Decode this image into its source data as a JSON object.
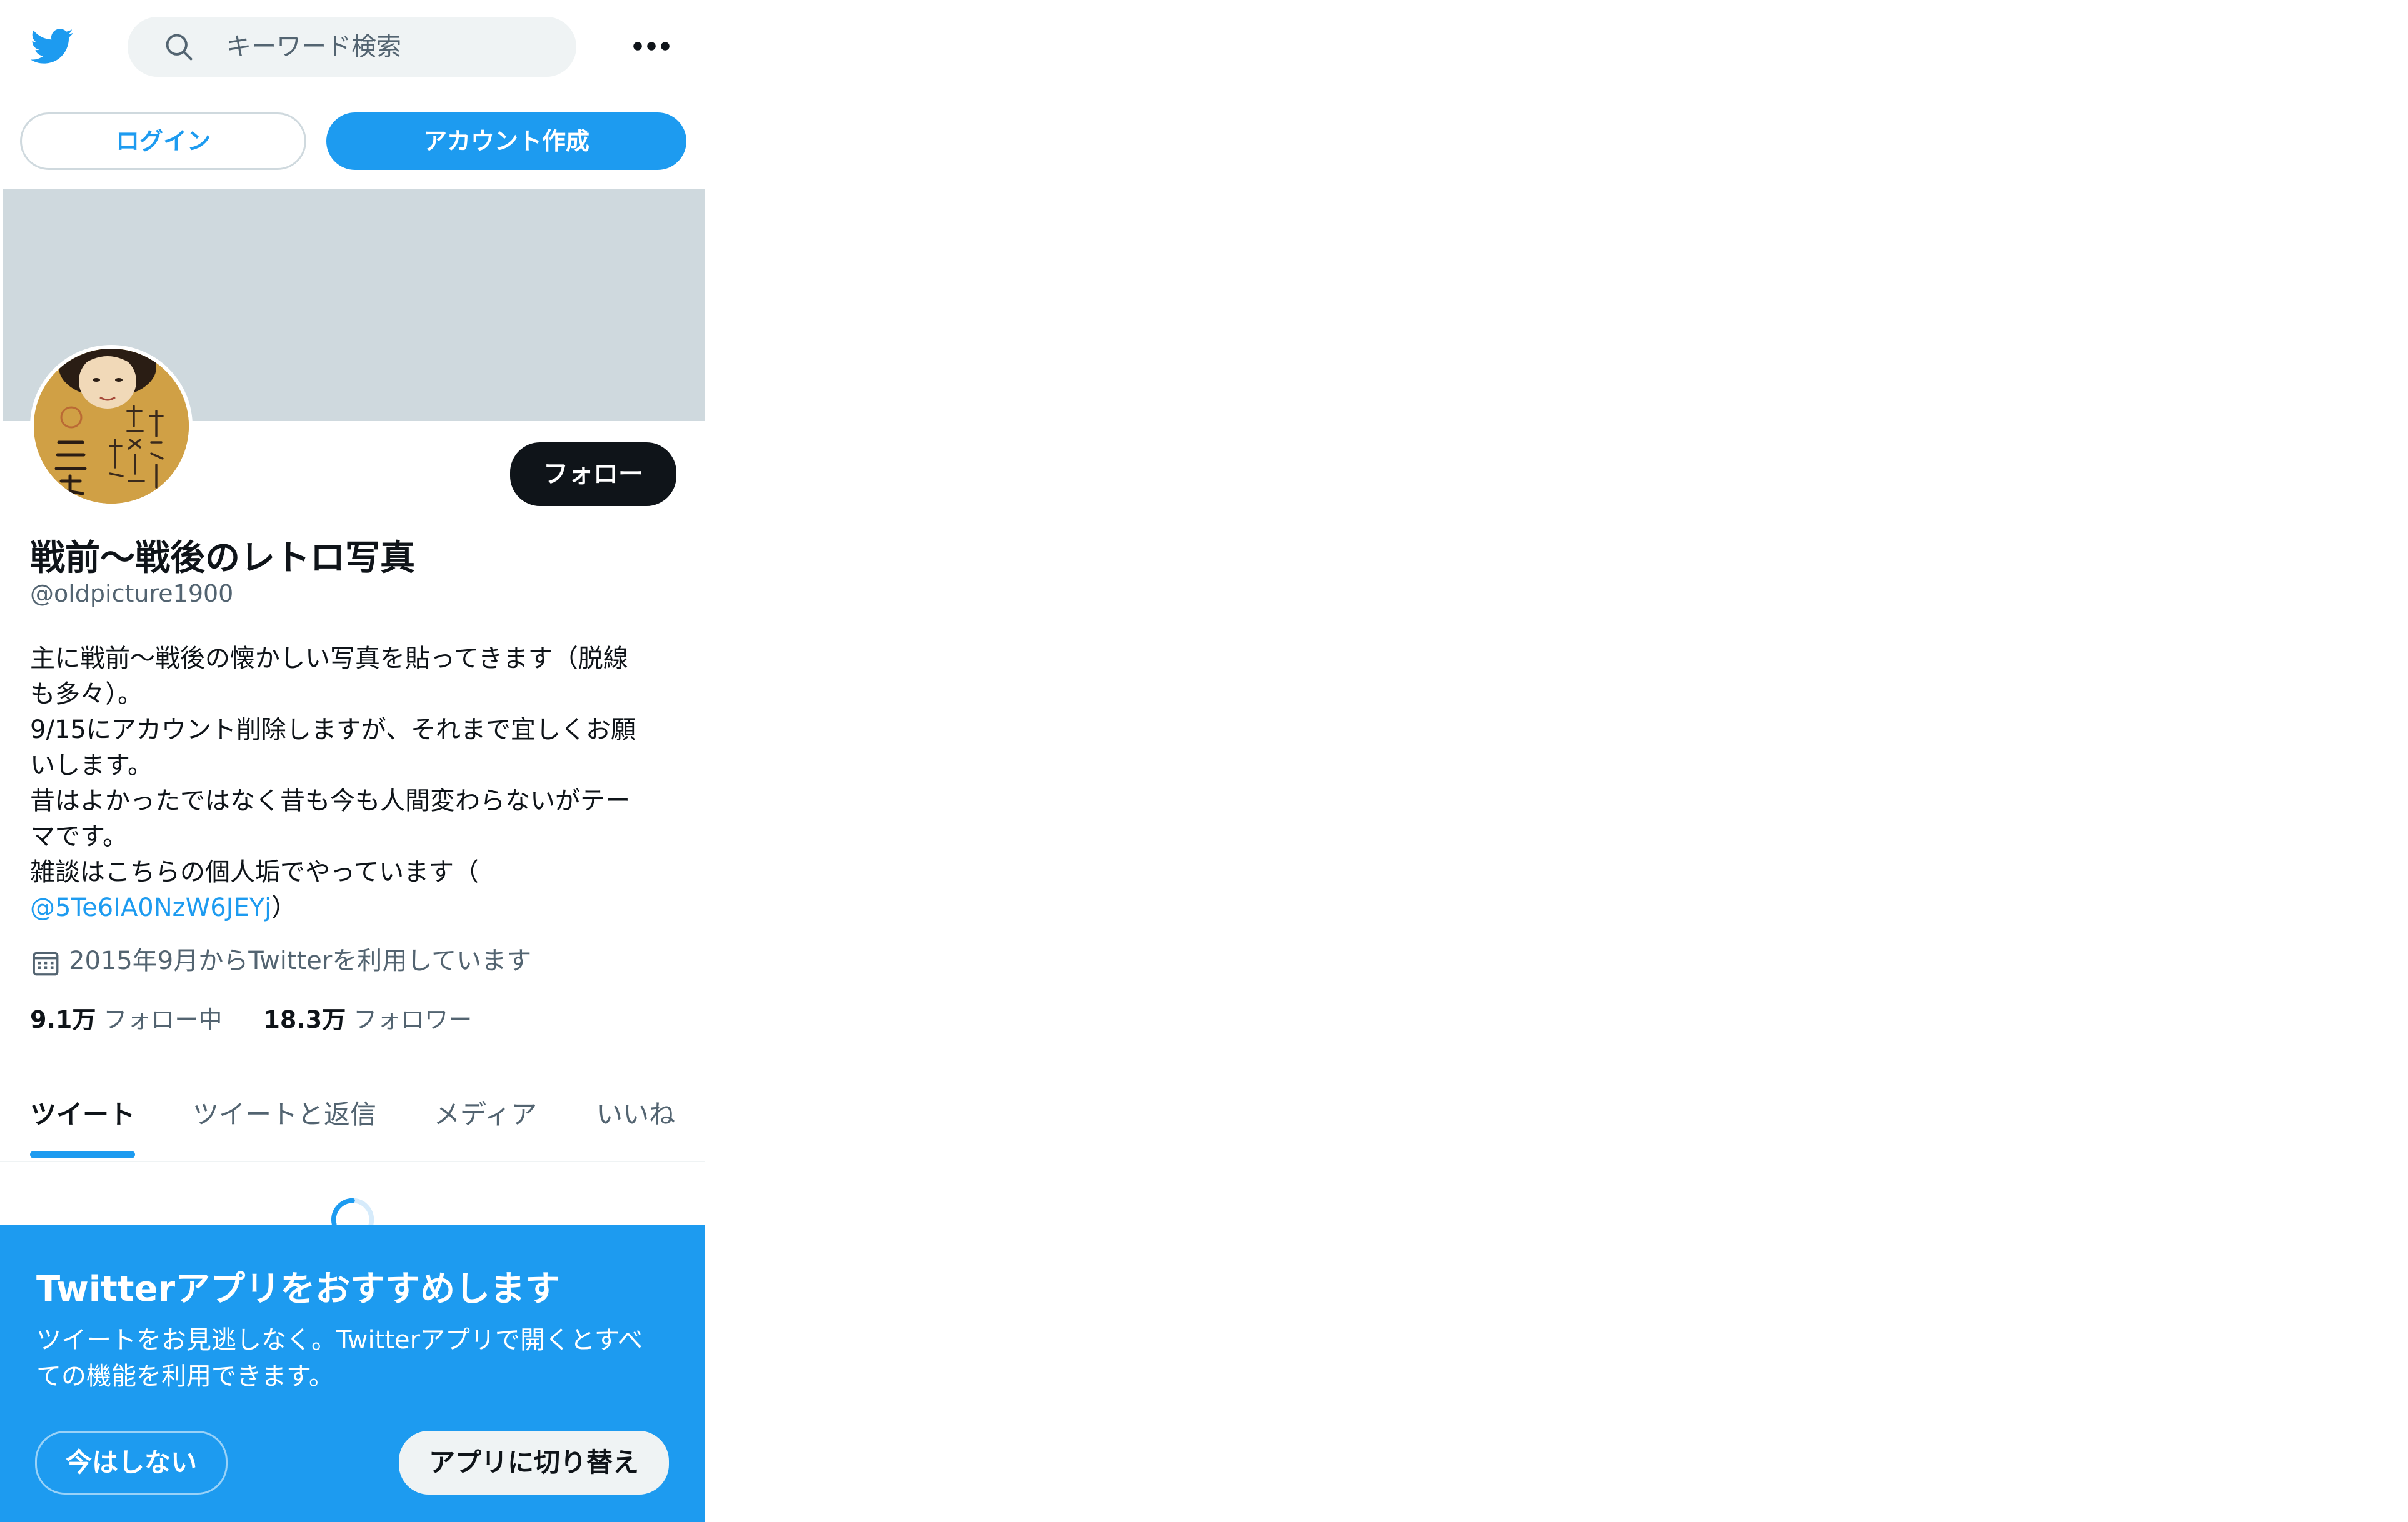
{
  "header": {
    "logo": "twitter-bird-icon",
    "search_placeholder": "キーワード検索",
    "search_icon": "search-icon",
    "more_icon": "more-icon"
  },
  "auth": {
    "login_label": "ログイン",
    "signup_label": "アカウント作成"
  },
  "profile": {
    "display_name": "戦前～戦後のレトロ写真",
    "handle": "@oldpicture1900",
    "follow_label": "フォロー",
    "bio_lines": [
      "主に戦前～戦後の懐かしい写真を貼ってきます（脱線",
      "も多々）。",
      "9/15にアカウント削除しますが、それまで宜しくお願",
      "いします。",
      "昔はよかったではなく昔も今も人間変わらないがテー",
      "マです。",
      "雑談はこちらの個人垢でやっています（"
    ],
    "bio_link": "@5Te6IA0NzW6JEYj",
    "bio_link_suffix": "）",
    "joined": "2015年9月からTwitterを利用しています",
    "following_count": "9.1万",
    "following_label": "フォロー中",
    "followers_count": "18.3万",
    "followers_label": "フォロワー"
  },
  "tabs": [
    {
      "label": "ツイート",
      "active": true
    },
    {
      "label": "ツイートと返信",
      "active": false
    },
    {
      "label": "メディア",
      "active": false
    },
    {
      "label": "いいね",
      "active": false
    }
  ],
  "promo": {
    "title": "Twitterアプリをおすすめします",
    "desc_lines": [
      "ツイートをお見逃しなく。Twitterアプリで開くとすべ",
      "ての機能を利用できます。"
    ],
    "not_now_label": "今はしない",
    "switch_label": "アプリに切り替え"
  },
  "colors": {
    "accent": "#1d9bf0",
    "banner": "#cfd9de",
    "text": "#0f1419",
    "secondary": "#536471"
  }
}
